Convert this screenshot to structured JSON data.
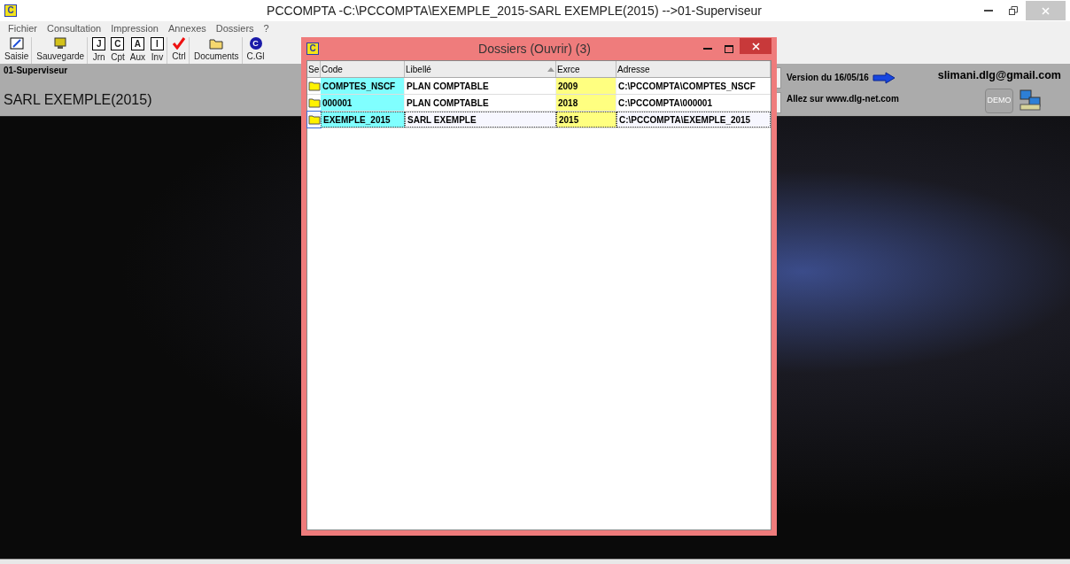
{
  "window": {
    "logo": "C",
    "title": "PCCOMPTA -C:\\PCCOMPTA\\EXEMPLE_2015-SARL EXEMPLE(2015) -->01-Superviseur"
  },
  "menu": [
    "Fichier",
    "Consultation",
    "Impression",
    "Annexes",
    "Dossiers",
    "?"
  ],
  "toolbar": [
    {
      "label": "Saisie",
      "kind": "pen"
    },
    {
      "label": "Sauvegarde",
      "kind": "save"
    },
    {
      "label": "Jrn",
      "kind": "letter",
      "letter": "J"
    },
    {
      "label": "Cpt",
      "kind": "letter",
      "letter": "C"
    },
    {
      "label": "Aux",
      "kind": "letter",
      "letter": "A"
    },
    {
      "label": "Inv",
      "kind": "letter",
      "letter": "I"
    },
    {
      "label": "Ctrl",
      "kind": "check"
    },
    {
      "label": "Documents",
      "kind": "folder"
    },
    {
      "label": "C.Gl",
      "kind": "circle",
      "letter": "C"
    }
  ],
  "user": "01-Superviseur",
  "company": "SARL EXEMPLE(2015)",
  "info": {
    "version": "Version du 16/05/16",
    "site": "Allez sur  www.dlg-net.com",
    "email": "slimani.dlg@gmail.com",
    "demo": "DEMO"
  },
  "dialog": {
    "logo": "C",
    "title": "Dossiers (Ouvrir)  (3)",
    "columns": [
      "Se",
      "Code",
      "Libellé",
      "Exrce",
      "Adresse"
    ],
    "rows": [
      {
        "code": "COMPTES_NSCF",
        "libelle": "PLAN COMPTABLE",
        "exrce": "2009",
        "adresse": "C:\\PCCOMPTA\\COMPTES_NSCF",
        "selected": false
      },
      {
        "code": "000001",
        "libelle": "PLAN COMPTABLE",
        "exrce": "2018",
        "adresse": "C:\\PCCOMPTA\\000001",
        "selected": false
      },
      {
        "code": "EXEMPLE_2015",
        "libelle": "SARL EXEMPLE",
        "exrce": "2015",
        "adresse": "C:\\PCCOMPTA\\EXEMPLE_2015",
        "selected": true
      }
    ]
  }
}
